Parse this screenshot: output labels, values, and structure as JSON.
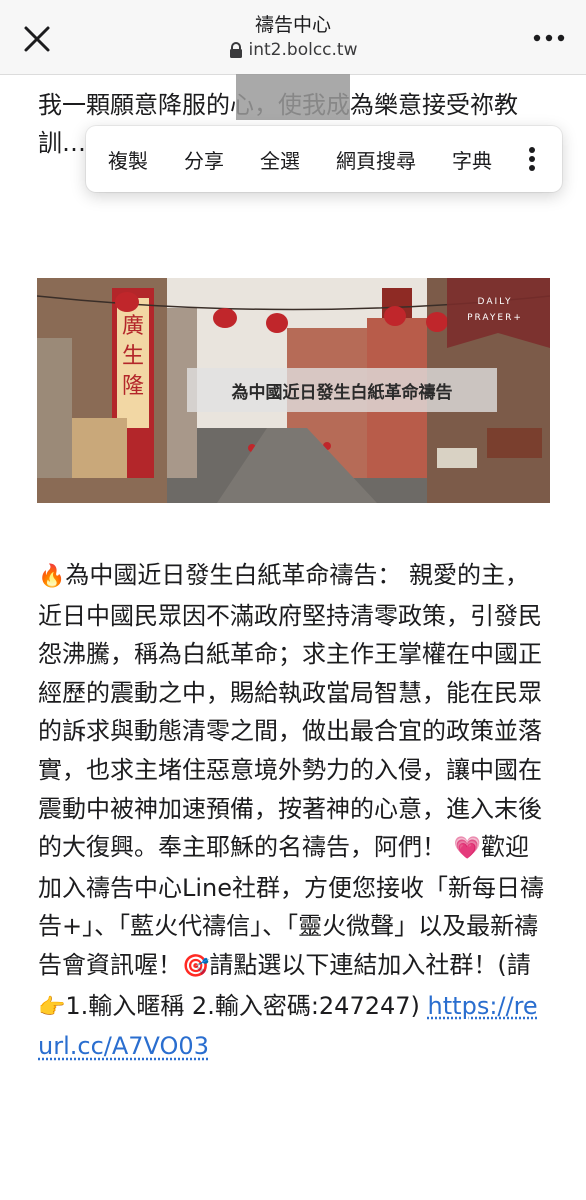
{
  "header": {
    "title": "禱告中心",
    "url": "int2.bolcc.tw"
  },
  "intro": {
    "text": "我一顆願意降服的心，使我成為樂意接受祢教訓……服祢……"
  },
  "context_menu": {
    "items": [
      "複製",
      "分享",
      "全選",
      "網頁搜尋",
      "字典"
    ]
  },
  "banner": {
    "caption": "為中國近日發生白紙革命禱告",
    "tag_line1": "DAILY",
    "tag_line2": "PRAYER+",
    "colors": {
      "sign_red": "#b3262a",
      "sky": "#e9e4dd",
      "street": "#6d6a66"
    }
  },
  "article": {
    "fire_emoji": "🔥",
    "heading_text": "為中國近日發生白紙革命禱告：",
    "paragraph_1": "親愛的主，近日中國民眾因不滿政府堅持清零政策，引發民怨沸騰，稱為白紙革命；求主作王掌權在中國正經歷的震動之中，賜給執政當局智慧，能在民眾的訴求與動態清零之間，做出最合宜的政策並落實，也求主堵住惡意境外勢力的入侵，讓中國在震動中被神加速預備，按著神的心意，進入末後的大復興。奉主耶穌的名禱告，阿們！",
    "heart_emoji": "💗",
    "paragraph_2": "歡迎加入禱告中心Line社群，方便您接收「新每日禱告+」、「藍火代禱信」、「靈火微聲」以及最新禱告會資訊喔！",
    "target_emoji": "🎯",
    "paragraph_3": "請點選以下連結加入社群！(請",
    "hand_emoji": "👉",
    "paragraph_4": "1.輸入暱稱 2.輸入密碼:247247)",
    "link_text": "https://reurl.cc/A7VO03"
  },
  "colors": {
    "link": "#2a6ecf",
    "text": "#1c1c1e",
    "topbar_bg": "#f7f7f7"
  }
}
